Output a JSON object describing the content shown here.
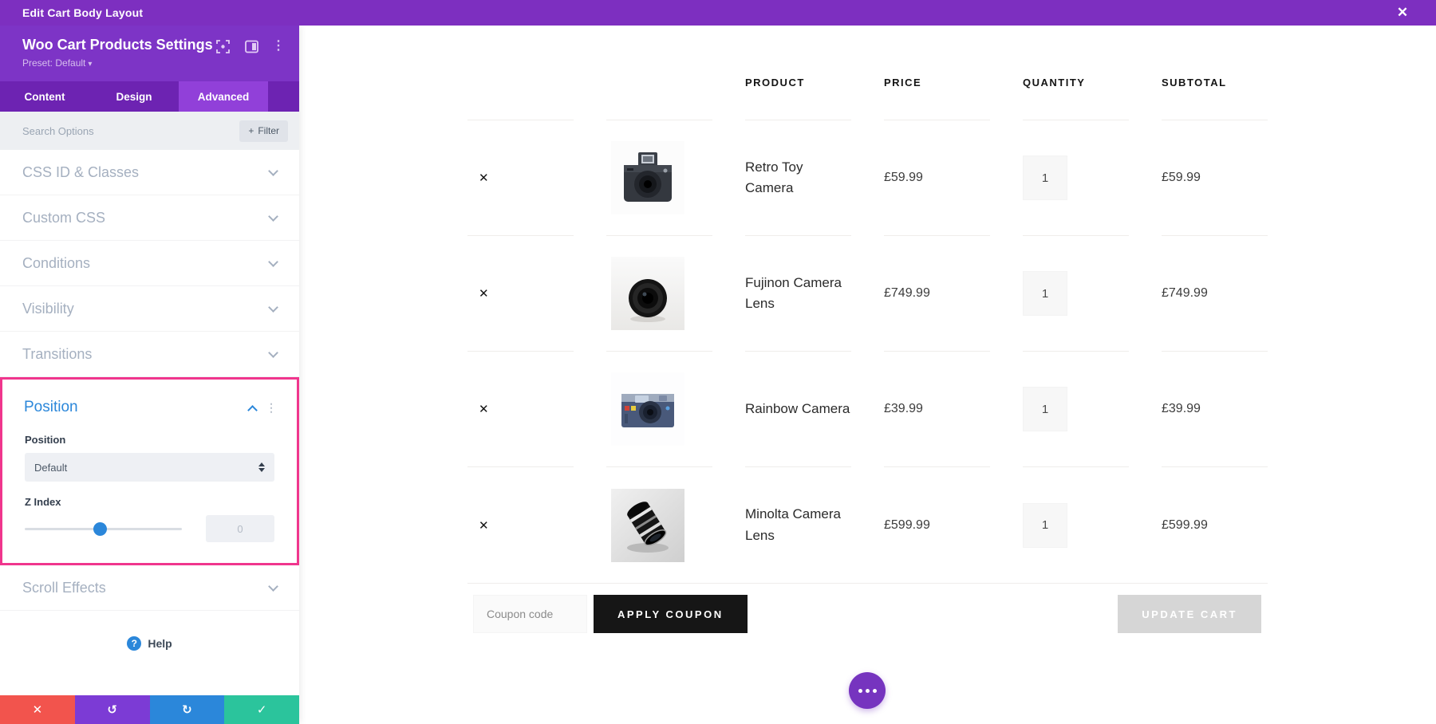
{
  "topbar": {
    "title": "Edit Cart Body Layout"
  },
  "panel": {
    "title": "Woo Cart Products Settings",
    "preset": "Preset: Default",
    "tabs": [
      {
        "label": "Content",
        "active": false
      },
      {
        "label": "Design",
        "active": false
      },
      {
        "label": "Advanced",
        "active": true
      }
    ],
    "search": {
      "placeholder": "Search Options",
      "filter_label": "Filter"
    },
    "sections_above": [
      "CSS ID & Classes",
      "Custom CSS",
      "Conditions",
      "Visibility",
      "Transitions"
    ],
    "position_group": {
      "title": "Position",
      "position_field_label": "Position",
      "position_value": "Default",
      "zindex_label": "Z Index",
      "zindex_value": "0"
    },
    "sections_below": [
      "Scroll Effects"
    ],
    "help_label": "Help"
  },
  "cart": {
    "headers": {
      "product": "PRODUCT",
      "price": "PRICE",
      "quantity": "QUANTITY",
      "subtotal": "SUBTOTAL"
    },
    "products": [
      {
        "name": "Retro Toy Camera",
        "price": "£59.99",
        "quantity": "1",
        "subtotal": "£59.99",
        "image": "retro-toy-camera"
      },
      {
        "name": "Fujinon Camera Lens",
        "price": "£749.99",
        "quantity": "1",
        "subtotal": "£749.99",
        "image": "fujinon-camera-lens"
      },
      {
        "name": "Rainbow Camera",
        "price": "£39.99",
        "quantity": "1",
        "subtotal": "£39.99",
        "image": "rainbow-camera"
      },
      {
        "name": "Minolta Camera Lens",
        "price": "£599.99",
        "quantity": "1",
        "subtotal": "£599.99",
        "image": "minolta-camera-lens"
      }
    ],
    "coupon": {
      "placeholder": "Coupon code",
      "apply_label": "APPLY COUPON",
      "update_label": "UPDATE CART"
    }
  },
  "icons": {
    "close": "✕",
    "remove": "✕",
    "filter_plus": "+",
    "preset_caret": "▾",
    "help": "?",
    "kebab": "⋮",
    "discard": "✕",
    "undo": "↺",
    "redo": "↻",
    "save": "✓"
  },
  "colors": {
    "accent_purple": "#7d2fc0",
    "tab_active": "#9140d9",
    "highlight_pink": "#f0368d",
    "link_blue": "#2b87da",
    "discard_red": "#f2544d",
    "save_green": "#2bc49c",
    "apply_black": "#161616",
    "update_gray": "#d6d6d6"
  }
}
